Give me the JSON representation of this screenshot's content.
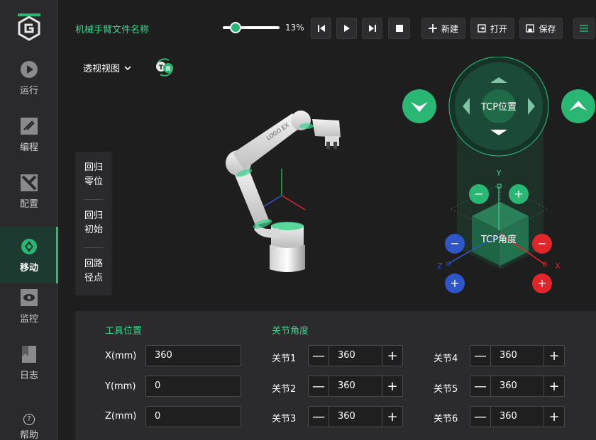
{
  "app": {
    "file_name": "机械手臂文件名称",
    "speed_percent": 13,
    "speed_text": "13%"
  },
  "sidebar": {
    "items": [
      {
        "label": "运行",
        "icon": "play-icon"
      },
      {
        "label": "编程",
        "icon": "code-icon"
      },
      {
        "label": "配置",
        "icon": "config-icon"
      },
      {
        "label": "移动",
        "icon": "move-icon",
        "active": true
      },
      {
        "label": "监控",
        "icon": "monitor-icon"
      },
      {
        "label": "日志",
        "icon": "log-icon"
      }
    ],
    "help_label": "帮助",
    "help_glyph": "?"
  },
  "toolbar": {
    "new_label": "新建",
    "open_label": "打开",
    "save_label": "保存"
  },
  "view": {
    "selected": "透视视图",
    "tr_t": "T",
    "tr_r": "R"
  },
  "actions": [
    {
      "line1": "回归",
      "line2": "零位"
    },
    {
      "line1": "回归",
      "line2": "初始"
    },
    {
      "line1": "回路",
      "line2": "径点"
    }
  ],
  "robot": {
    "arm_text": "LOGO EX"
  },
  "jog": {
    "tcp_position_label": "TCP位置",
    "tcp_angle_label": "TCP角度",
    "axis_y": "Y",
    "axis_z": "Z",
    "axis_x": "X",
    "minus": "−",
    "plus": "+"
  },
  "tool_position": {
    "title": "工具位置",
    "rows": [
      {
        "label": "X(mm)",
        "value": "360"
      },
      {
        "label": "Y(mm)",
        "value": "0"
      },
      {
        "label": "Z(mm)",
        "value": "0"
      }
    ]
  },
  "joint_angles": {
    "title": "关节角度",
    "joints": [
      {
        "label": "关节1",
        "value": "360"
      },
      {
        "label": "关节2",
        "value": "360"
      },
      {
        "label": "关节3",
        "value": "360"
      },
      {
        "label": "关节4",
        "value": "360"
      },
      {
        "label": "关节5",
        "value": "360"
      },
      {
        "label": "关节6",
        "value": "360"
      }
    ],
    "minus_glyph": "—",
    "plus_glyph": "+"
  },
  "colors": {
    "accent": "#2ab673",
    "accent_text": "#3fd28c",
    "background": "#1e1e1f",
    "panel": "#2b2b2d",
    "red": "#e0262b",
    "blue": "#2f56c6"
  }
}
